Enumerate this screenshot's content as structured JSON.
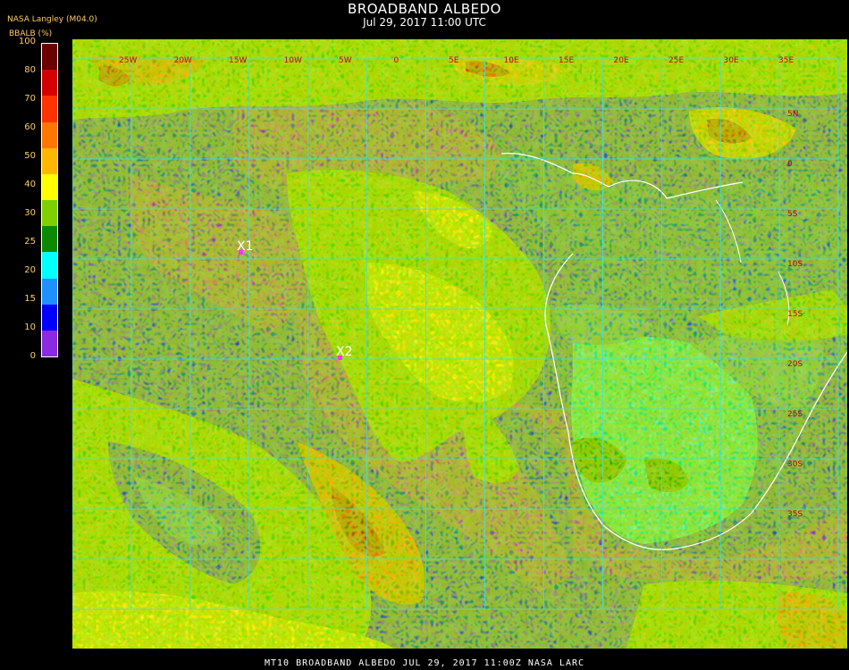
{
  "header": {
    "title": "BROADBAND ALBEDO",
    "subtitle": "Jul 29, 2017 11:00 UTC",
    "source": "NASA Langley (M04.0)",
    "colorbar_label": "BBALB (%)"
  },
  "colorbar": {
    "ticks": [
      "100",
      "80",
      "70",
      "60",
      "50",
      "40",
      "30",
      "25",
      "20",
      "15",
      "10",
      "0"
    ],
    "colors": [
      "#6b0000",
      "#d40000",
      "#ff3300",
      "#ff7700",
      "#ffb800",
      "#ffff00",
      "#7ed000",
      "#0b8a00",
      "#00ffff",
      "#1e90ff",
      "#0000ff",
      "#8a2be2"
    ]
  },
  "markers": [
    {
      "label": "X1",
      "color": "#ff33ff"
    },
    {
      "label": "X2",
      "color": "#ff33ff"
    }
  ],
  "grid": {
    "color": "#40e0e0",
    "lon_labels": [
      "25W",
      "20W",
      "15W",
      "10W",
      "5W",
      "0",
      "5E",
      "10E",
      "15E",
      "20E",
      "25E",
      "30E",
      "35E"
    ],
    "lat_labels": [
      "5N",
      "0",
      "5S",
      "10S",
      "15S",
      "20S",
      "25S",
      "30S",
      "35S"
    ]
  },
  "footer": "MT10   BROADBAND ALBEDO   JUL 29, 2017 11:00Z   NASA LARC"
}
